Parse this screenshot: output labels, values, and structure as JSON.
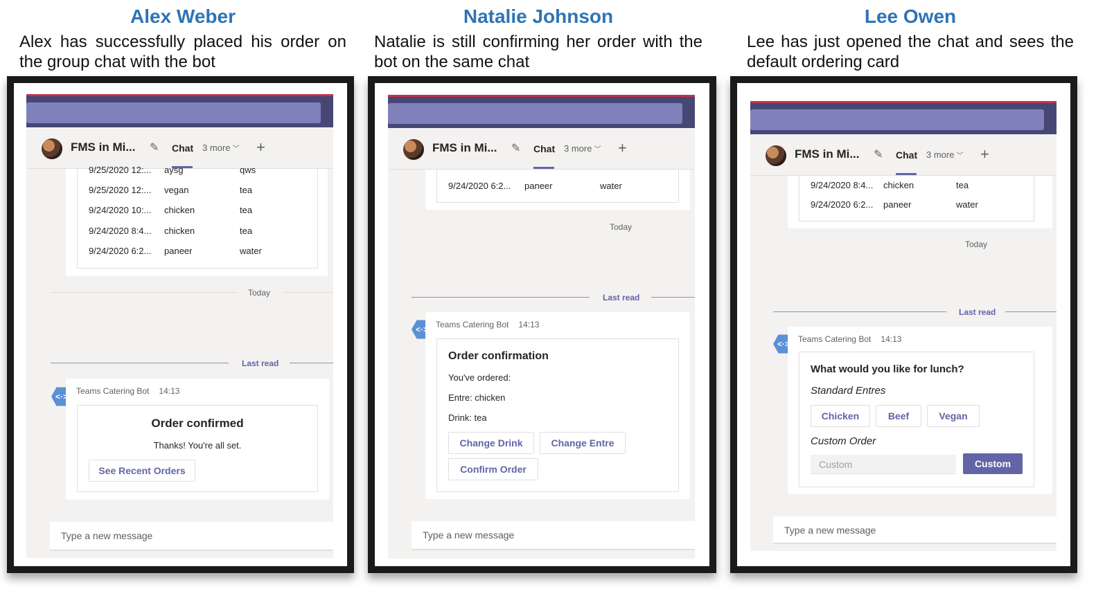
{
  "columns": [
    {
      "name": "Alex Weber",
      "description": "Alex has successfully placed his order on the group chat with the bot"
    },
    {
      "name": "Natalie Johnson",
      "description": "Natalie is still confirming her order with the bot on the same chat"
    },
    {
      "name": "Lee Owen",
      "description": "Lee has just opened the chat and sees the default ordering card"
    }
  ],
  "teams": {
    "chat_title": "FMS in Mi...",
    "tab_chat": "Chat",
    "tab_more": "3 more",
    "today": "Today",
    "last_read": "Last read",
    "bot_name": "Teams Catering Bot",
    "bot_time": "14:13",
    "compose_placeholder": "Type a new message"
  },
  "alex": {
    "orders": [
      {
        "date": "9/25/2020 12:...",
        "entre": "aysg",
        "drink": "qws"
      },
      {
        "date": "9/25/2020 12:...",
        "entre": "vegan",
        "drink": "tea"
      },
      {
        "date": "9/24/2020 10:...",
        "entre": "chicken",
        "drink": "tea"
      },
      {
        "date": "9/24/2020 8:4...",
        "entre": "chicken",
        "drink": "tea"
      },
      {
        "date": "9/24/2020 6:2...",
        "entre": "paneer",
        "drink": "water"
      }
    ],
    "card_title": "Order confirmed",
    "card_text": "Thanks! You're all set.",
    "button": "See Recent Orders"
  },
  "natalie": {
    "orders": [
      {
        "date": "9/24/2020 6:2...",
        "entre": "paneer",
        "drink": "water"
      }
    ],
    "card_title": "Order confirmation",
    "line1": "You've ordered:",
    "line2": "Entre: chicken",
    "line3": "Drink: tea",
    "btn_change_drink": "Change Drink",
    "btn_change_entre": "Change Entre",
    "btn_confirm": "Confirm Order"
  },
  "lee": {
    "orders": [
      {
        "date": "9/24/2020 8:4...",
        "entre": "chicken",
        "drink": "tea"
      },
      {
        "date": "9/24/2020 6:2...",
        "entre": "paneer",
        "drink": "water"
      }
    ],
    "card_title": "What would you like for lunch?",
    "standard_label": "Standard Entres",
    "btn_chicken": "Chicken",
    "btn_beef": "Beef",
    "btn_vegan": "Vegan",
    "custom_label": "Custom Order",
    "custom_placeholder": "Custom",
    "btn_custom": "Custom"
  },
  "colors": {
    "heading_blue": "#2e74b5",
    "teams_purple": "#6264a7",
    "topbar": "#464775"
  }
}
